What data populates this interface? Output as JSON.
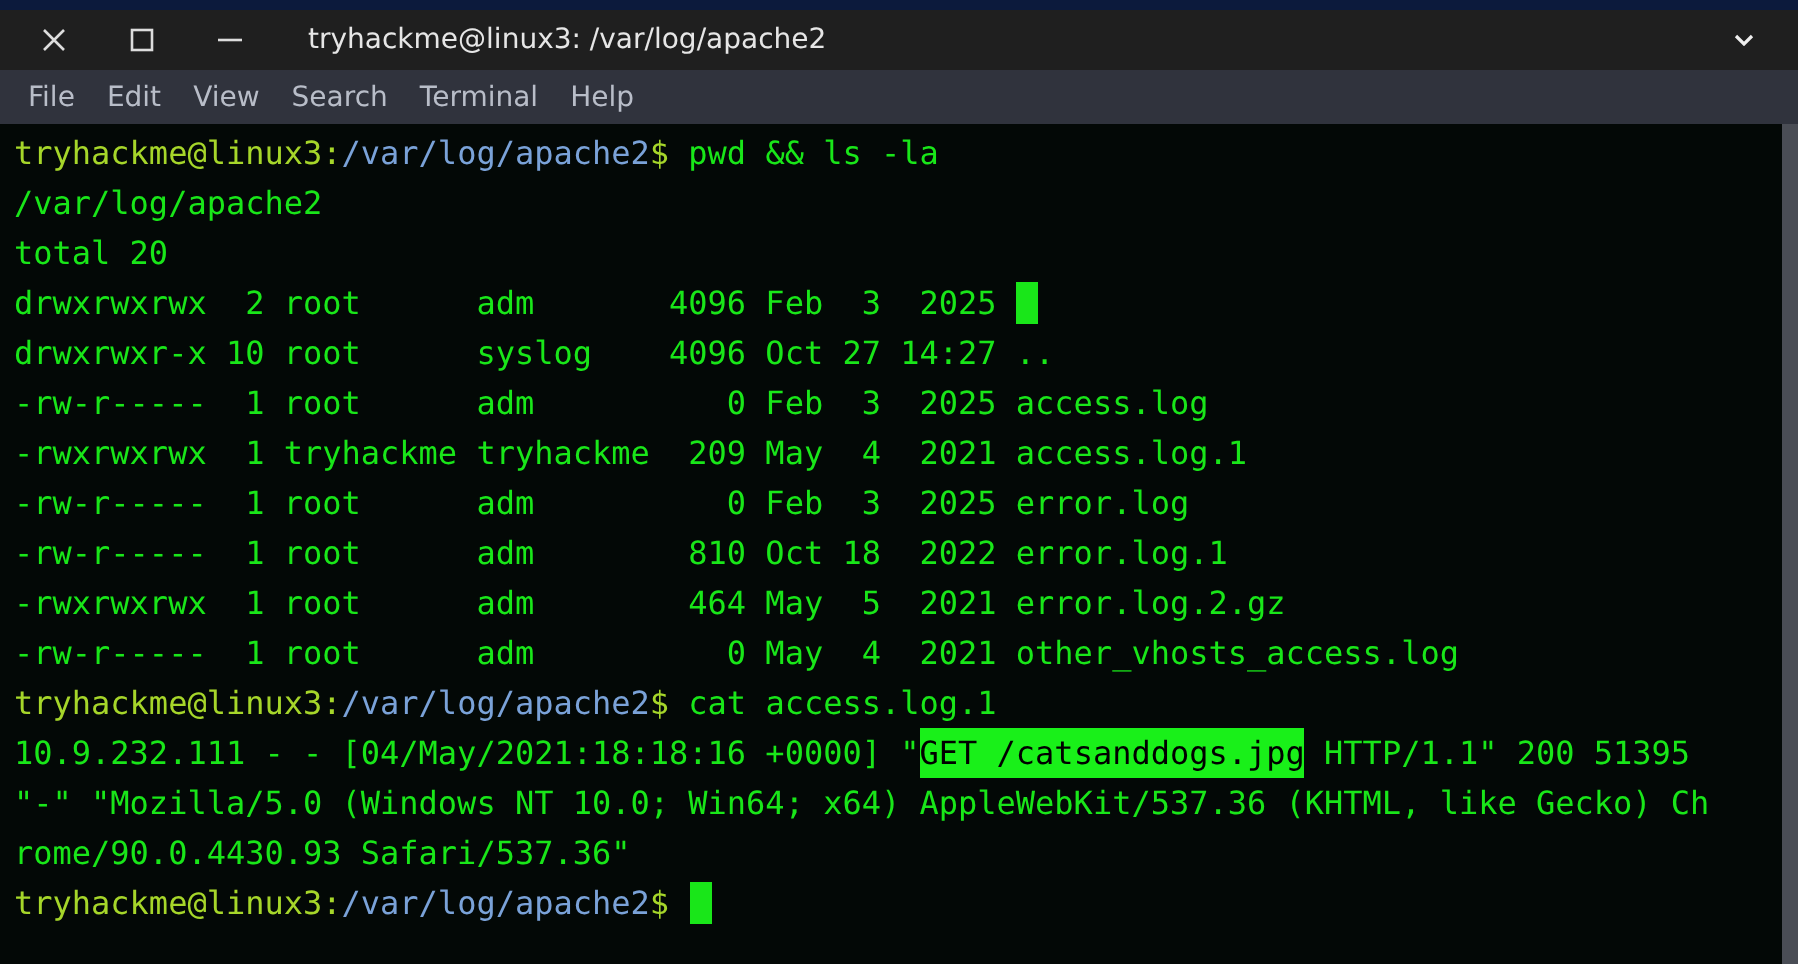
{
  "window": {
    "title": "tryhackme@linux3: /var/log/apache2"
  },
  "menu": [
    "File",
    "Edit",
    "View",
    "Search",
    "Terminal",
    "Help"
  ],
  "terminal": {
    "lines": [
      {
        "kind": "prompt",
        "user": "tryhackme@linux3:",
        "path": "/var/log/apache2",
        "symbol": "$",
        "command": "pwd && ls -la"
      },
      {
        "kind": "output",
        "segments": [
          {
            "kind": "text",
            "text": "/var/log/apache2"
          }
        ]
      },
      {
        "kind": "output",
        "segments": [
          {
            "kind": "text",
            "text": "total 20"
          }
        ]
      },
      {
        "kind": "output",
        "segments": [
          {
            "kind": "text",
            "text": "drwxrwxrwx  2 root      adm       4096 Feb  3  2025"
          },
          {
            "kind": "block"
          }
        ]
      },
      {
        "kind": "output",
        "segments": [
          {
            "kind": "text",
            "text": "drwxrwxr-x 10 root      syslog    4096 Oct 27 14:27 .."
          }
        ]
      },
      {
        "kind": "output",
        "segments": [
          {
            "kind": "text",
            "text": "-rw-r-----  1 root      adm          0 Feb  3  2025 access.log"
          }
        ]
      },
      {
        "kind": "output",
        "segments": [
          {
            "kind": "text",
            "text": "-rwxrwxrwx  1 tryhackme tryhackme  209 May  4  2021 access.log.1"
          }
        ]
      },
      {
        "kind": "output",
        "segments": [
          {
            "kind": "text",
            "text": "-rw-r-----  1 root      adm          0 Feb  3  2025 error.log"
          }
        ]
      },
      {
        "kind": "output",
        "segments": [
          {
            "kind": "text",
            "text": "-rw-r-----  1 root      adm        810 Oct 18  2022 error.log.1"
          }
        ]
      },
      {
        "kind": "output",
        "segments": [
          {
            "kind": "text",
            "text": "-rwxrwxrwx  1 root      adm        464 May  5  2021 error.log.2.gz"
          }
        ]
      },
      {
        "kind": "output",
        "segments": [
          {
            "kind": "text",
            "text": "-rw-r-----  1 root      adm          0 May  4  2021 other_vhosts_access.log"
          }
        ]
      },
      {
        "kind": "prompt",
        "user": "tryhackme@linux3:",
        "path": "/var/log/apache2",
        "symbol": "$",
        "command": "cat access.log.1"
      },
      {
        "kind": "output",
        "segments": [
          {
            "kind": "text",
            "text": "10.9.232.111 - - [04/May/2021:18:18:16 +0000] \""
          },
          {
            "kind": "mark",
            "text": "GET /catsanddogs.jpg"
          },
          {
            "kind": "text",
            "text": " HTTP/1.1\" 200 51395"
          }
        ]
      },
      {
        "kind": "output",
        "segments": [
          {
            "kind": "text",
            "text": "\"-\" \"Mozilla/5.0 (Windows NT 10.0; Win64; x64) AppleWebKit/537.36 (KHTML, like Gecko) Ch"
          }
        ]
      },
      {
        "kind": "output",
        "segments": [
          {
            "kind": "text",
            "text": "rome/90.0.4430.93 Safari/537.36\""
          }
        ]
      },
      {
        "kind": "prompt",
        "user": "tryhackme@linux3:",
        "path": "/var/log/apache2",
        "symbol": "$",
        "cursor": true
      }
    ]
  }
}
